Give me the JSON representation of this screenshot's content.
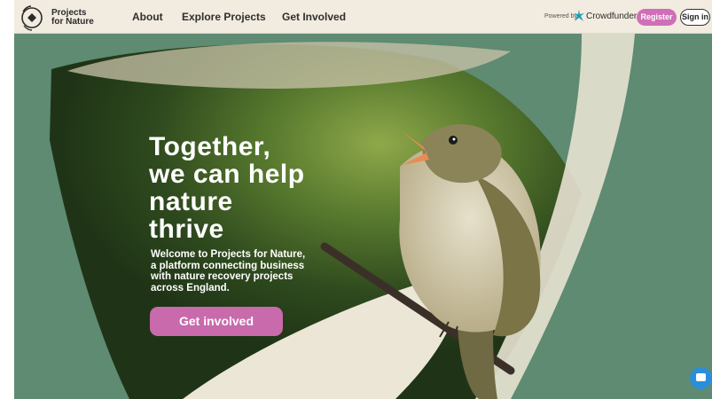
{
  "header": {
    "logo_line1": "Projects",
    "logo_line2": "for Nature",
    "nav": [
      "About",
      "Explore Projects",
      "Get Involved"
    ],
    "powered_by": "Powered by",
    "crowdfunder": "Crowdfunder",
    "register": "Register",
    "sign_in": "Sign in"
  },
  "hero": {
    "headline_lines": [
      "Together,",
      "we can help",
      "nature",
      "thrive"
    ],
    "intro_lines": [
      "Welcome to Projects for Nature,",
      "a platform connecting business",
      "with nature recovery projects",
      "across England."
    ],
    "cta": "Get involved"
  },
  "icons": {
    "logo": "projects-for-nature-logo",
    "crowdfunder": "crowdfunder-icon",
    "chat": "chat-icon"
  },
  "colors": {
    "header_bg": "#f2ebe0",
    "hero_green": "#5e8b72",
    "accent_pink": "#c86aab"
  }
}
